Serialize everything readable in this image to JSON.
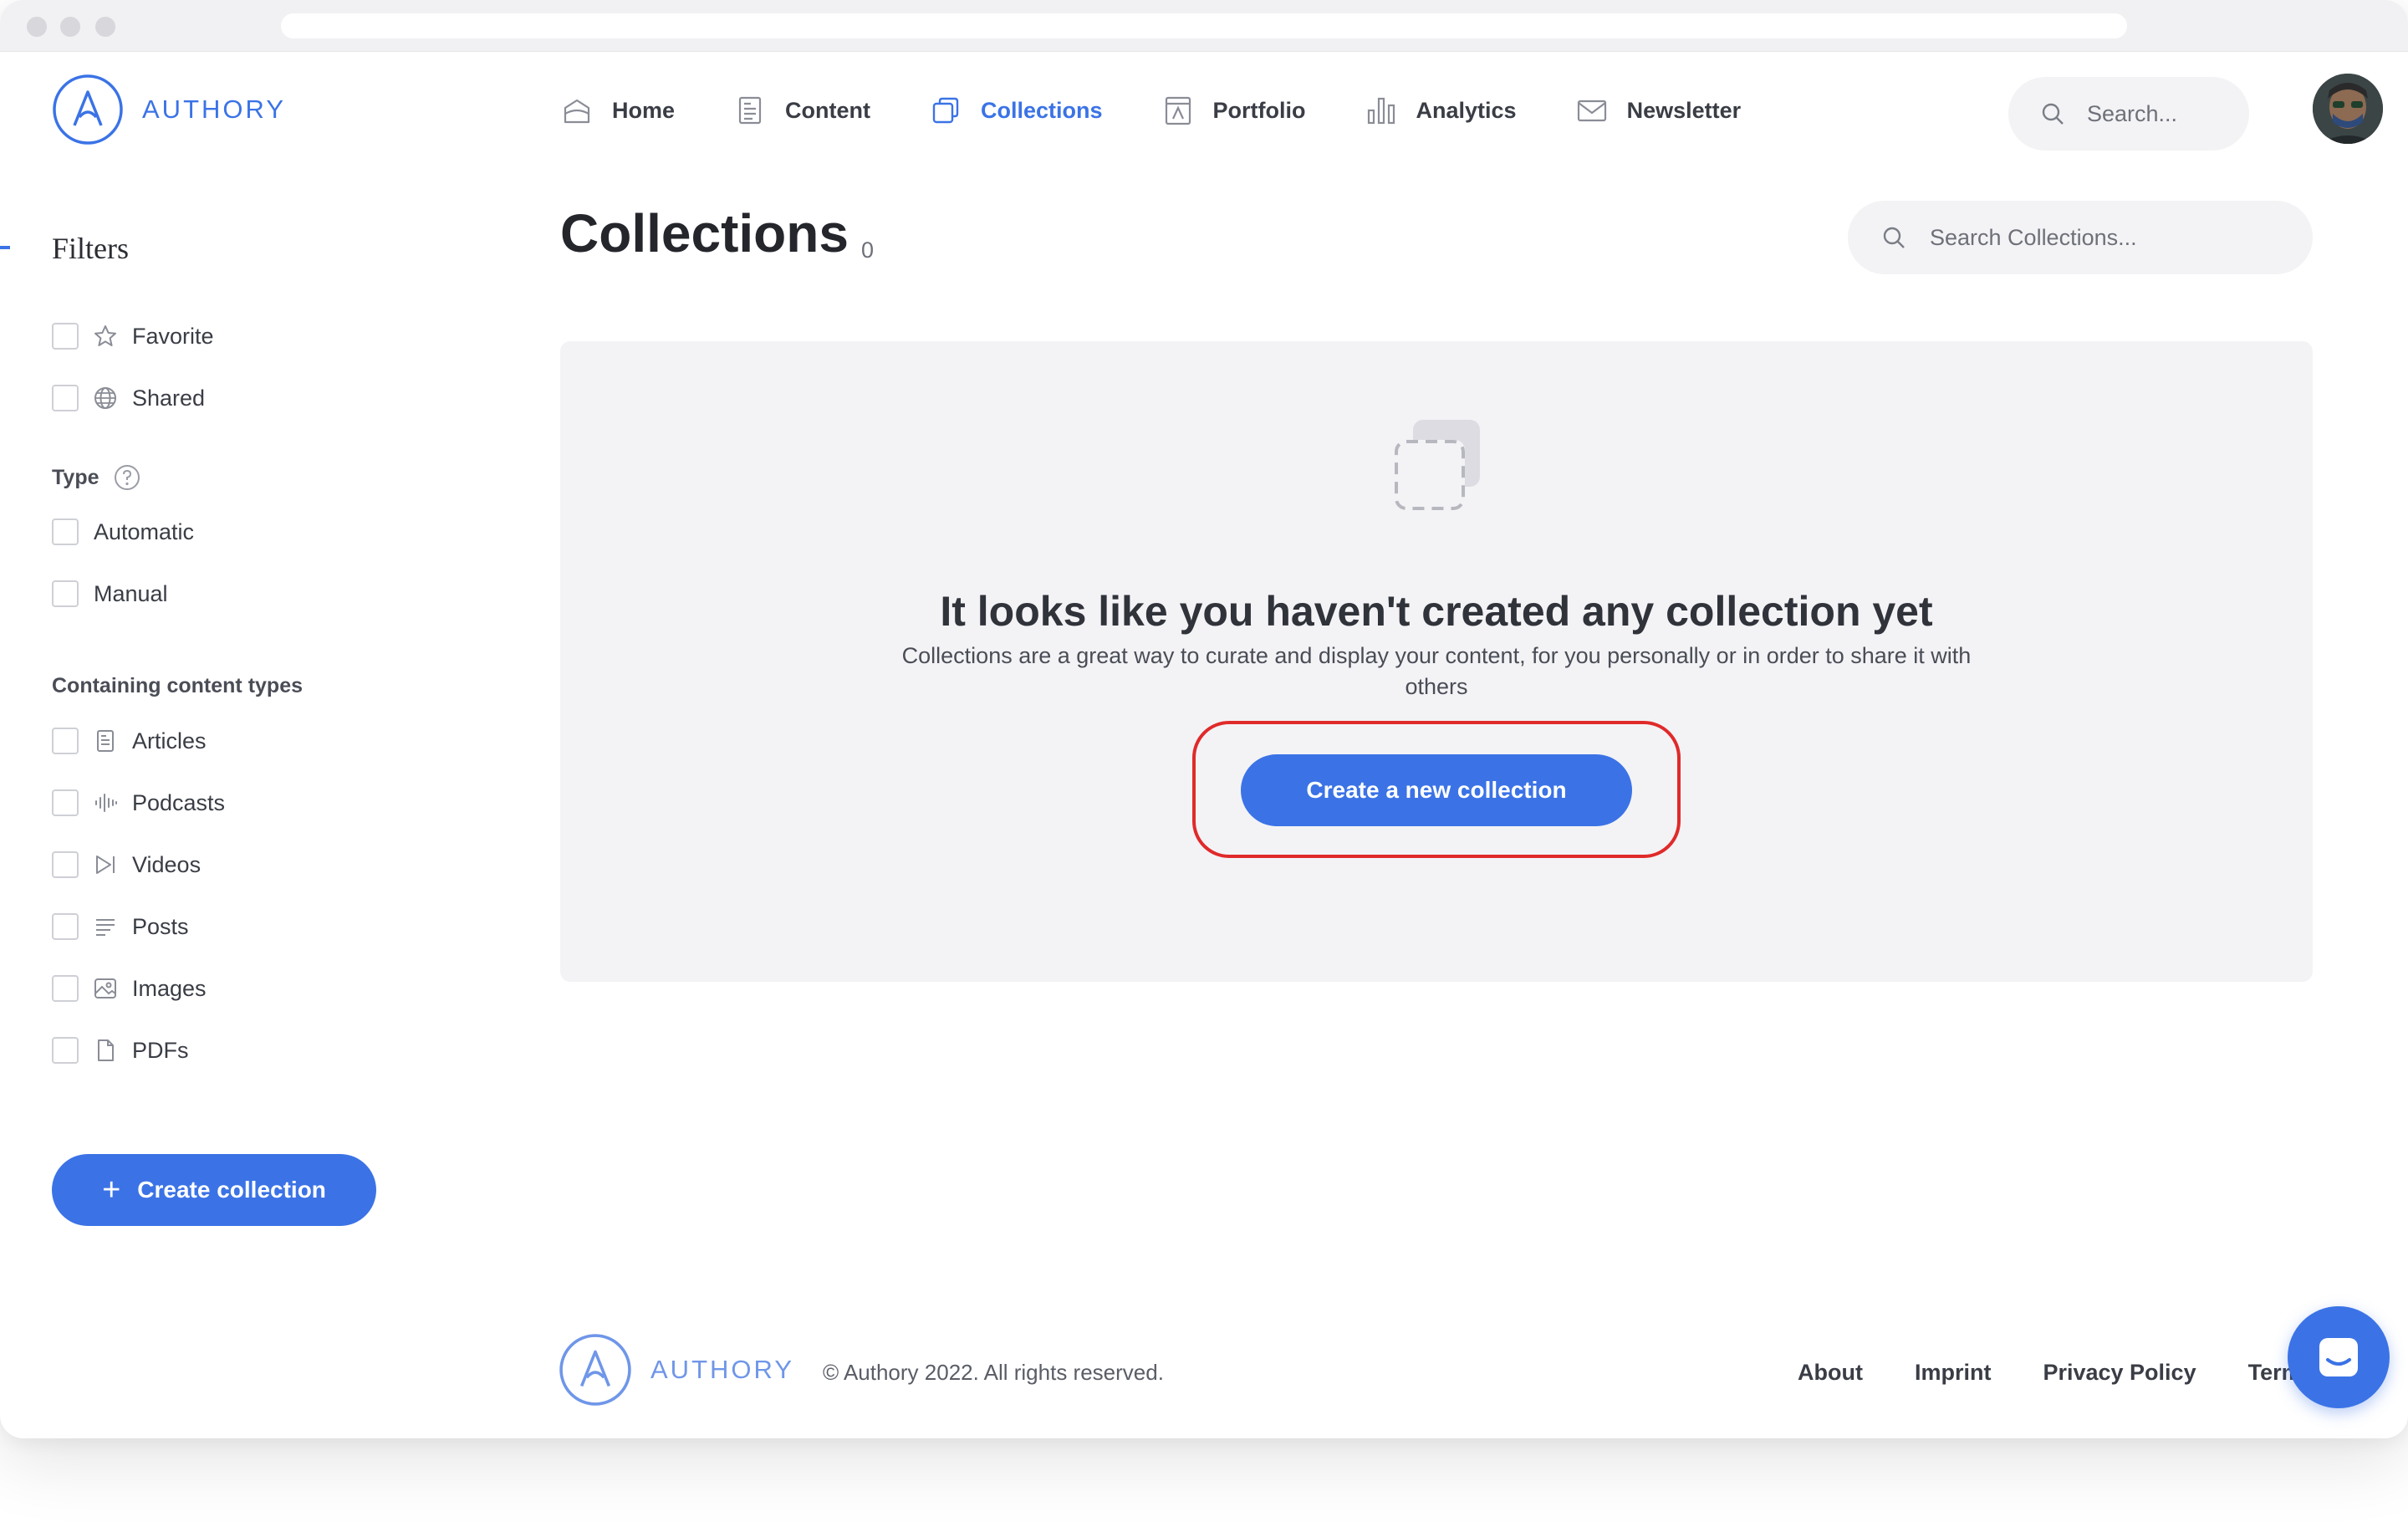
{
  "brand": {
    "name": "AUTHORY",
    "color": "#3b73e6"
  },
  "nav": {
    "items": [
      {
        "label": "Home",
        "icon": "home-icon",
        "active": false
      },
      {
        "label": "Content",
        "icon": "content-icon",
        "active": false
      },
      {
        "label": "Collections",
        "icon": "collections-icon",
        "active": true
      },
      {
        "label": "Portfolio",
        "icon": "portfolio-icon",
        "active": false
      },
      {
        "label": "Analytics",
        "icon": "analytics-icon",
        "active": false
      },
      {
        "label": "Newsletter",
        "icon": "newsletter-icon",
        "active": false
      }
    ],
    "search_placeholder": "Search..."
  },
  "sidebar": {
    "title": "Filters",
    "general": [
      {
        "label": "Favorite",
        "icon": "star-icon",
        "checked": false
      },
      {
        "label": "Shared",
        "icon": "globe-icon",
        "checked": false
      }
    ],
    "type_label": "Type",
    "types": [
      {
        "label": "Automatic",
        "checked": false
      },
      {
        "label": "Manual",
        "checked": false
      }
    ],
    "content_types_label": "Containing content types",
    "content_types": [
      {
        "label": "Articles",
        "icon": "article-icon",
        "checked": false
      },
      {
        "label": "Podcasts",
        "icon": "podcast-icon",
        "checked": false
      },
      {
        "label": "Videos",
        "icon": "video-icon",
        "checked": false
      },
      {
        "label": "Posts",
        "icon": "post-icon",
        "checked": false
      },
      {
        "label": "Images",
        "icon": "image-icon",
        "checked": false
      },
      {
        "label": "PDFs",
        "icon": "pdf-icon",
        "checked": false
      }
    ],
    "create_button": "Create collection"
  },
  "main": {
    "title": "Collections",
    "count": "0",
    "search_placeholder": "Search Collections...",
    "empty": {
      "heading": "It looks like you haven't created any collection yet",
      "subtext": "Collections are a great way to curate and display your content, for you personally or in order to share it with others",
      "button": "Create a new collection"
    }
  },
  "footer": {
    "brand": "AUTHORY",
    "copyright": "© Authory 2022. All rights reserved.",
    "links": [
      "About",
      "Imprint",
      "Privacy Policy",
      "Terms"
    ]
  },
  "colors": {
    "accent": "#3b73e6",
    "highlight": "#e02a2a",
    "panel": "#f3f3f6"
  }
}
